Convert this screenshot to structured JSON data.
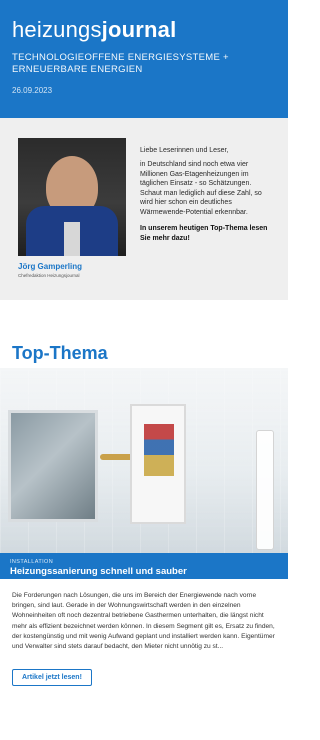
{
  "header": {
    "brand_light": "heizungs",
    "brand_bold": "journal",
    "subtitle": "TECHNOLOGIEOFFENE ENERGIESYSTEME + ERNEUERBARE ENERGIEN",
    "date": "26.09.2023"
  },
  "intro": {
    "author_name": "Jörg Gamperling",
    "author_role": "Chefredaktion Heizungsjournal",
    "greeting": "Liebe Leserinnen und Leser,",
    "body": "in Deutschland sind noch etwa vier Millionen Gas-Etagenheizungen im täglichen Einsatz - so Schätzungen. Schaut man lediglich auf diese Zahl, so wird hier schon ein deutliches Wärmewende-Potential erkennbar.",
    "cta": "In unserem heutigen Top-Thema lesen Sie mehr dazu!"
  },
  "top_thema": {
    "section_title": "Top-Thema",
    "kicker": "INSTALLATION",
    "headline": "Heizungssanierung schnell und sauber",
    "article": "Die Forderungen nach Lösungen, die uns im Bereich der Energiewende nach vorne bringen, sind laut. Gerade in der Wohnungswirtschaft werden in den einzelnen Wohneinheiten oft noch dezentral betriebene Gasthermen unterhalten, die längst nicht mehr als effizient bezeichnet werden können. In diesem Segment gilt es, Ersatz zu finden, der kostengünstig und mit wenig Aufwand geplant und installiert werden kann. Eigentümer und Verwalter sind stets darauf bedacht, den Mieter nicht unnötig zu st...",
    "button_label": "Artikel jetzt lesen!"
  },
  "colors": {
    "brand_blue": "#1b76c7",
    "intro_bg": "#efefef"
  },
  "icons": {
    "author_photo": "portrait-photo",
    "hero_image": "bathroom-boiler-photo"
  }
}
